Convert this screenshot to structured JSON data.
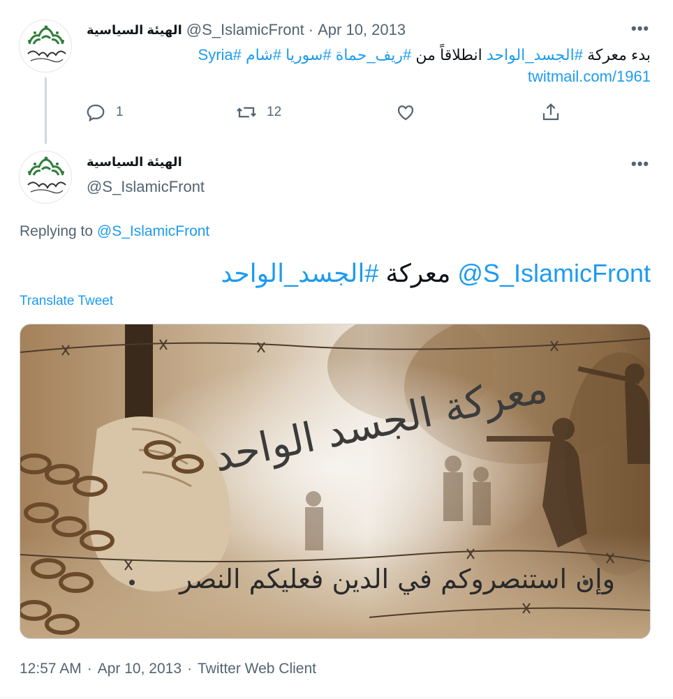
{
  "first_tweet": {
    "display_name": "الهيئة السياسية",
    "handle": "@S_IslamicFront",
    "separator": "·",
    "date": "Apr 10, 2013",
    "text_prefix": "بدء معركة",
    "hashtag_body": "#الجسد_الواحد",
    "text_middle": "انطلاقاً من",
    "hashtags": [
      "#ريف_حماة",
      "#سوريا",
      "#شام",
      "#Syria"
    ],
    "link": "twitmail.com/1961",
    "actions": {
      "reply_count": "1",
      "retweet_count": "12"
    },
    "icons": [
      "reply-icon",
      "retweet-icon",
      "like-icon",
      "share-icon",
      "more-icon"
    ]
  },
  "main_tweet": {
    "display_name": "الهيئة السياسية",
    "handle": "@S_IslamicFront",
    "replying_label": "Replying to",
    "replying_handle": "@S_IslamicFront",
    "text_mention": "@S_IslamicFront",
    "text_word": "معركة",
    "text_hashtag": "#الجسد_الواحد",
    "translate_label": "Translate Tweet",
    "image": {
      "calligraphy_title": "معركة الجسد الواحد",
      "verse": "وإن استنصروكم في الدين فعليكم النصر"
    },
    "meta": {
      "time": "12:57 AM",
      "date": "Apr 10, 2013",
      "client": "Twitter Web Client",
      "separator": "·"
    }
  },
  "colors": {
    "accent": "#1d9bf0",
    "muted": "#536471",
    "text": "#0f1419",
    "logo_green": "#2e7d3a"
  }
}
